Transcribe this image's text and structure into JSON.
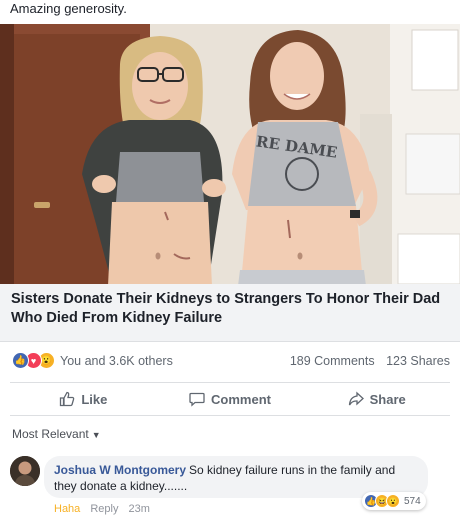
{
  "post": {
    "caption": "Amazing generosity.",
    "shirt_text": "RE DAME",
    "link_title": "Sisters Donate Their Kidneys to Strangers To Honor Their Dad Who Died From Kidney Failure"
  },
  "stats": {
    "reactions_text": "You and 3.6K others",
    "comments": "189 Comments",
    "shares": "123 Shares",
    "reaction_icons": [
      "like-icon",
      "love-icon",
      "wow-icon"
    ]
  },
  "actions": {
    "like": "Like",
    "comment": "Comment",
    "share": "Share"
  },
  "comments_section": {
    "sort_label": "Most Relevant"
  },
  "comment": {
    "author": "Joshua W Montgomery",
    "text": "So kidney failure runs in the family and they donate a kidney.......",
    "reaction_label": "Haha",
    "reply_label": "Reply",
    "time": "23m",
    "reaction_count": "574"
  },
  "colors": {
    "link": "#385898",
    "like_blue": "#4267b2",
    "love_red": "#f33e58",
    "wow_yellow": "#f7b125",
    "muted": "#606770"
  }
}
